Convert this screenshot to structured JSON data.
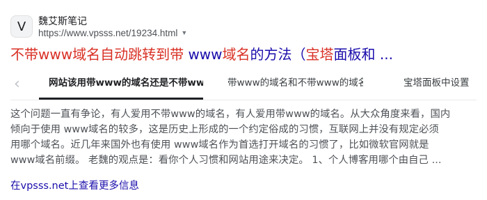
{
  "site": {
    "favicon_letter": "V",
    "name": "魏艾斯笔记",
    "url": "https://www.vpsss.net/19234.html",
    "url_menu_icon": "caret-down-icon"
  },
  "title": {
    "part1": "不带www域名自动跳转到带 ",
    "part2": "www",
    "part3": "域名",
    "part4": "的方法（",
    "part5": "宝塔",
    "part6": "面板和 ..."
  },
  "tabs": {
    "prev_icon": "chevron-left-icon",
    "items": [
      {
        "label": "网站该用带www的域名还是不带www的域名"
      },
      {
        "label": "带www的域名和不带www的域名区别"
      },
      {
        "label": "宝塔面板中设置"
      }
    ]
  },
  "snippet": {
    "lines": [
      "这个问题一直有争论，有人爱用不带www的域名，有人爱用带www的域名。从大众角度来看，国内",
      "倾向于使用 www域名的较多，这是历史上形成的一个约定俗成的习惯，互联网上并没有规定必须",
      "用哪个域名。近几年来国外也有使用 www域名作为首选打开域名的习惯了，比如微软官网就是",
      "www域名前缀。 老魏的观点是：看你个人习惯和网站用途来决定。 1、个人博客用哪个由自己 ..."
    ]
  },
  "more_link": "在vpsss.net上查看更多信息",
  "colors": {
    "link": "#1a0dab",
    "highlight": "#d93025",
    "snippet": "#4d5156"
  }
}
